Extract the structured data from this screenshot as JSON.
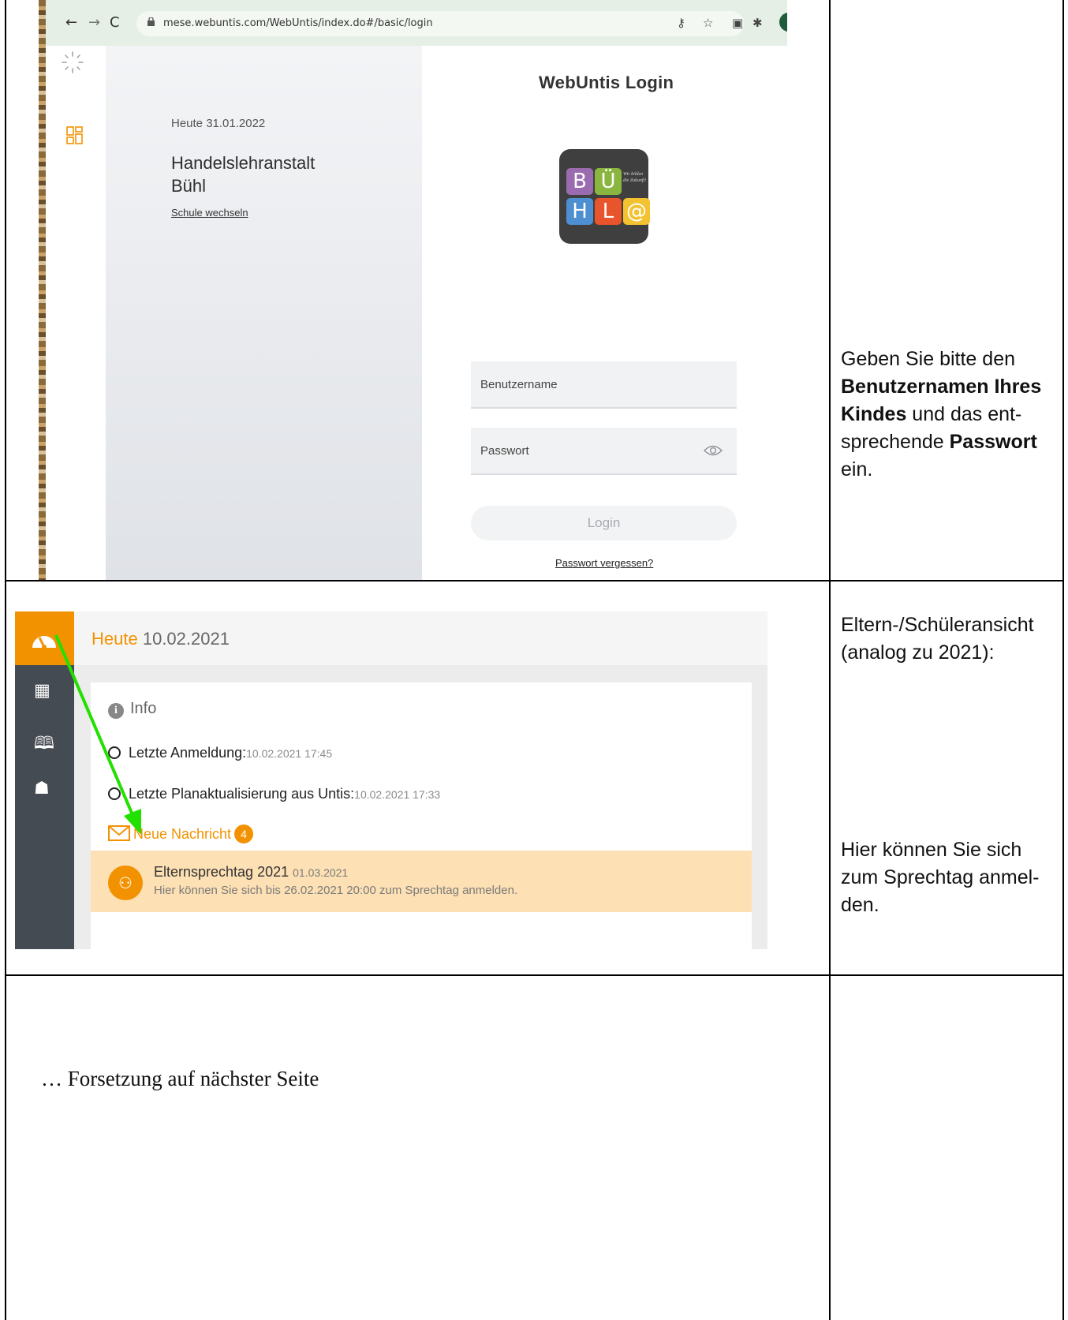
{
  "row1": {
    "browser": {
      "url": "mese.webuntis.com/WebUntis/index.do#/basic/login"
    },
    "login_page": {
      "date_label": "Heute 31.01.2022",
      "school_line1": "Handelslehranstalt",
      "school_line2": "Bühl",
      "switch_school": "Schule wechseln",
      "title": "WebUntis Login",
      "logo_letters": [
        "B",
        "Ü",
        "H",
        "L",
        "@"
      ],
      "logo_slogan": "Wir bilden die Zukunft!",
      "username_label": "Benutzername",
      "password_label": "Passwort",
      "login_button": "Login",
      "forgot_password": "Passwort vergessen?"
    },
    "instruction": {
      "part1": "Geben Sie bitte den ",
      "bold1": "Benutzernamen Ihres Kindes",
      "part2": " und das ent-sprechende ",
      "bold2": "Passwort",
      "part3": " ein."
    }
  },
  "row2": {
    "dashboard": {
      "today_word": "Heute",
      "today_date": "10.02.2021",
      "info_title": "Info",
      "last_login_label": "Letzte Anmeldung:",
      "last_login_value": "10.02.2021 17:45",
      "last_update_label": "Letzte Planaktualisierung aus Untis:",
      "last_update_value": "10.02.2021 17:33",
      "new_message_label": "Neue Nachricht",
      "new_message_count": "4",
      "event_title": "Elternsprechtag 2021",
      "event_date": "01.03.2021",
      "event_text": "Hier können Sie sich bis 26.02.2021 20:00 zum Sprechtag anmelden."
    },
    "note_top": "Eltern-/Schüleransicht (analog zu 2021):",
    "note_bottom": "Hier können Sie sich zum Sprechtag anmel-den."
  },
  "row3": {
    "continuation": "… Forsetzung auf nächster Seite"
  },
  "colors": {
    "accent_orange": "#f39200",
    "sidebar_dark": "#454b52",
    "event_bg": "#fde0b4",
    "arrow_green": "#22e000"
  }
}
